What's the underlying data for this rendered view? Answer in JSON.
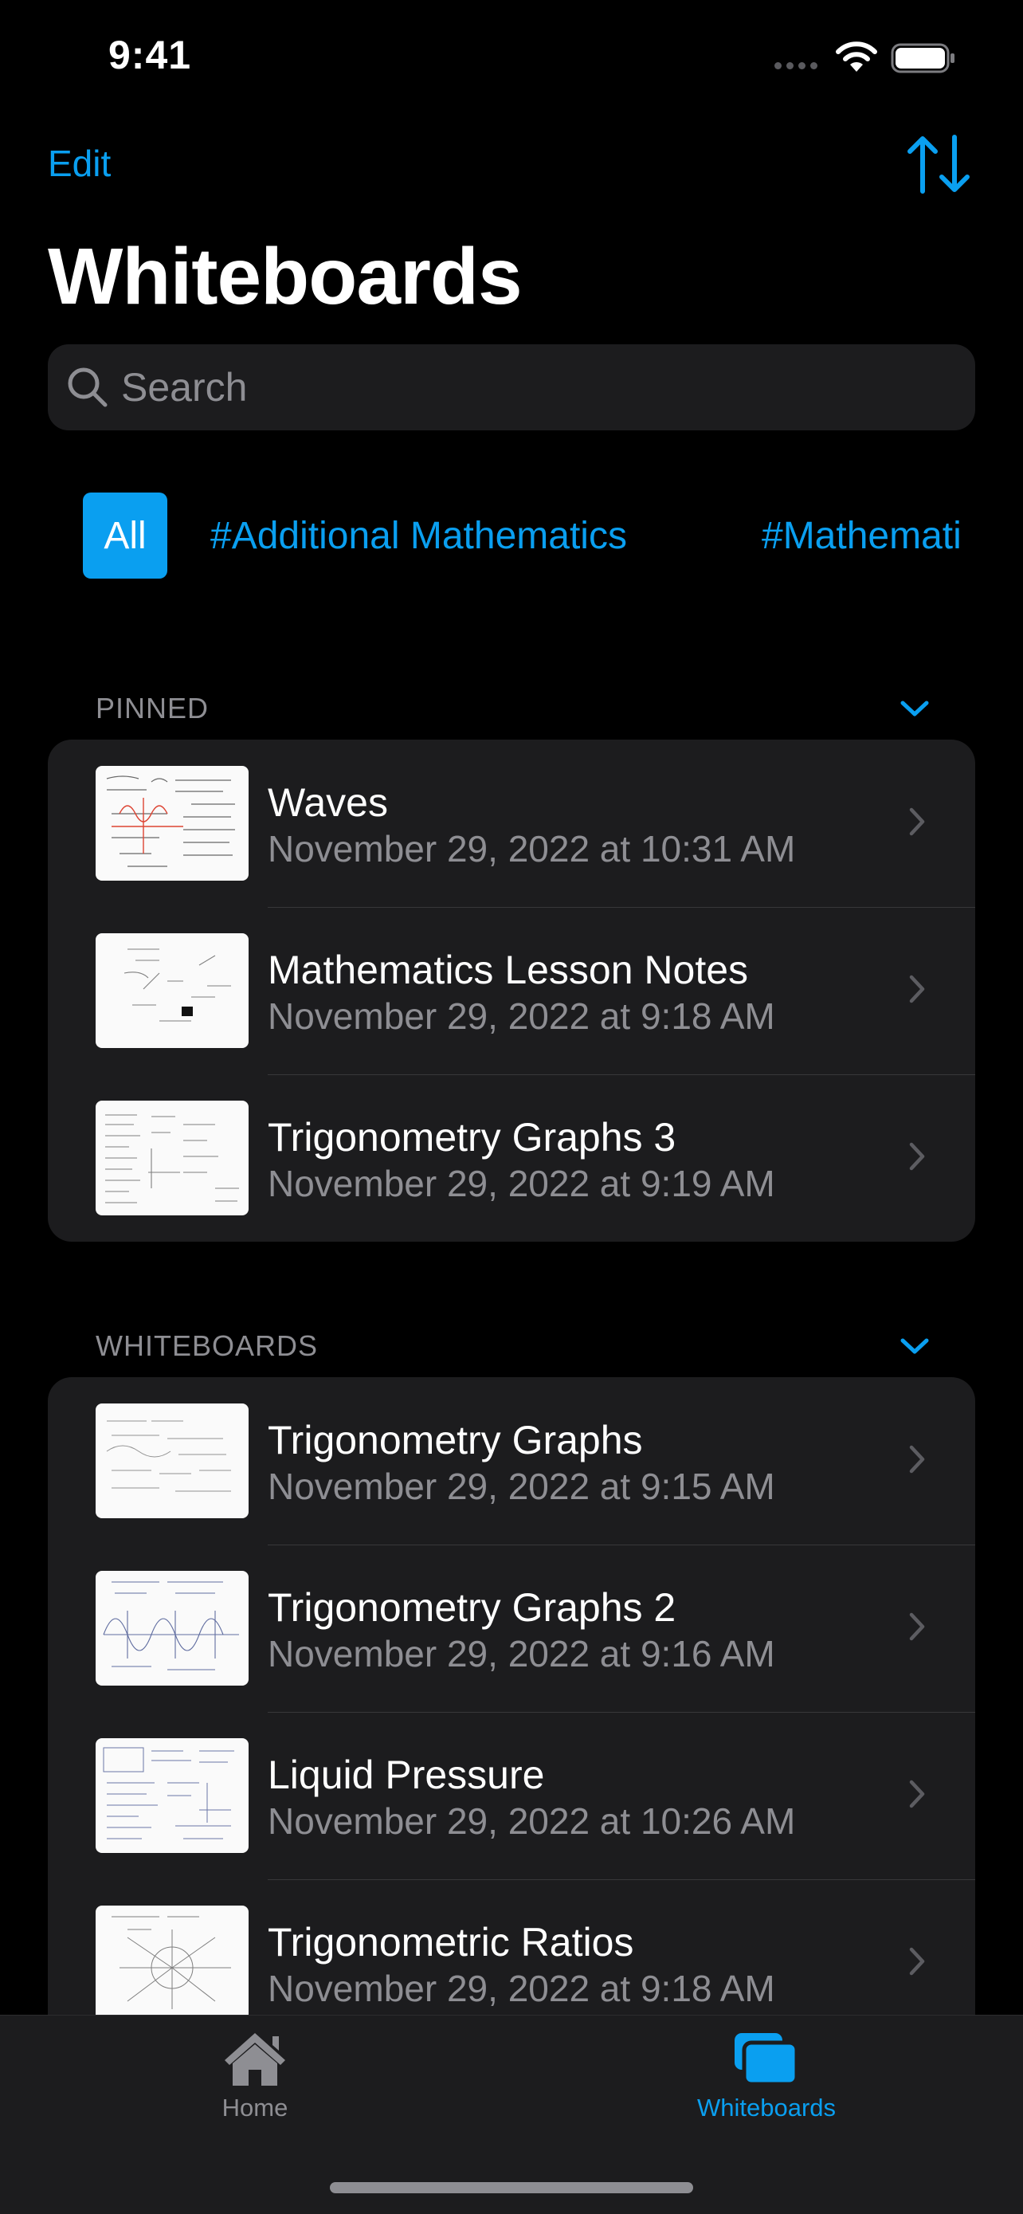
{
  "status_bar": {
    "time": "9:41"
  },
  "nav": {
    "edit_label": "Edit",
    "sort_icon": "arrow-up-down-icon",
    "title": "Whiteboards"
  },
  "search": {
    "placeholder": "Search"
  },
  "filters": {
    "items": [
      "All",
      "#Additional Mathematics",
      "#Mathemati"
    ],
    "selected": "All"
  },
  "sections": {
    "pinned": {
      "header": "PINNED",
      "items": [
        {
          "title": "Waves",
          "date": "November 29, 2022 at 10:31 AM"
        },
        {
          "title": "Mathematics Lesson Notes",
          "date": "November 29, 2022 at 9:18 AM"
        },
        {
          "title": "Trigonometry Graphs 3",
          "date": "November 29, 2022 at 9:19 AM"
        }
      ]
    },
    "whiteboards": {
      "header": "WHITEBOARDS",
      "items": [
        {
          "title": "Trigonometry Graphs",
          "date": "November 29, 2022 at 9:15 AM"
        },
        {
          "title": "Trigonometry Graphs 2",
          "date": "November 29, 2022 at 9:16 AM"
        },
        {
          "title": "Liquid Pressure",
          "date": "November 29, 2022 at 10:26 AM"
        },
        {
          "title": "Trigonometric Ratios",
          "date": "November 29, 2022 at 9:18 AM"
        }
      ]
    }
  },
  "tab_bar": {
    "tabs": [
      {
        "label": "Home",
        "icon": "house-icon",
        "selected": false
      },
      {
        "label": "Whiteboards",
        "icon": "stacked-squares-icon",
        "selected": true
      }
    ]
  },
  "colors": {
    "accent": "#0a9ff0",
    "background": "#000000",
    "card": "#1c1c1e",
    "secondary_text": "#8e8e93"
  }
}
